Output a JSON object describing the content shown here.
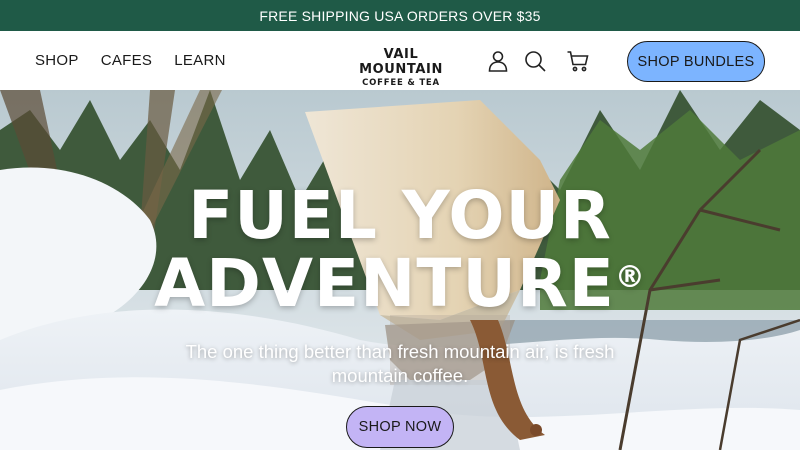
{
  "promo": {
    "text": "FREE SHIPPING USA ORDERS OVER $35"
  },
  "nav": {
    "items": [
      {
        "label": "SHOP"
      },
      {
        "label": "CAFES"
      },
      {
        "label": "LEARN"
      }
    ]
  },
  "brand": {
    "line1": "VAIL MOUNTAIN",
    "line2": "COFFEE & TEA"
  },
  "header_icons": [
    "account-icon",
    "search-icon",
    "cart-icon"
  ],
  "cta": {
    "bundles_label": "SHOP BUNDLES"
  },
  "hero": {
    "title_line1": "FUEL YOUR",
    "title_line2": "ADVENTURE",
    "title_mark": "®",
    "subtitle": "The one thing better than fresh mountain air, is fresh mountain coffee.",
    "button_label": "SHOP NOW"
  },
  "colors": {
    "promo_bg": "#1f5a47",
    "bundles_button": "#7cb4ff",
    "shop_now_button": "#c3b4f5"
  }
}
